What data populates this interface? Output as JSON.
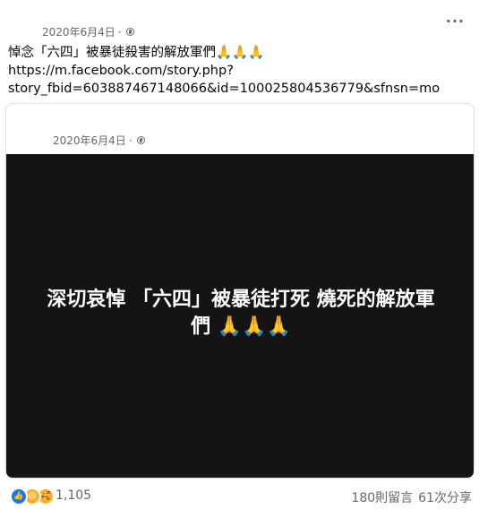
{
  "post": {
    "timestamp": "2020年6月4日",
    "separator": "·",
    "more_label": "···",
    "text_line1": "悼念「六四」被暴徒殺害的解放軍們🙏🙏🙏",
    "text_line2": "https://m.facebook.com/story.php?",
    "text_line3": "story_fbid=603887467148066&id=100025804536779&sfnsn=mo"
  },
  "shared": {
    "timestamp": "2020年6月4日",
    "separator": "·",
    "card_text_line1": "深切哀悼 「六四」被暴徒打死 燒死的解放軍",
    "card_text_line2": "們 🙏🙏🙏",
    "card_background": "#141414"
  },
  "footer": {
    "reaction_count": "1,105",
    "comments": "180則留言",
    "shares": "61次分享",
    "reactions": [
      "like-icon",
      "sad-icon",
      "care-icon"
    ]
  },
  "colors": {
    "meta": "#65676b",
    "like": "#1877f2",
    "emoji": "#f7b125"
  }
}
